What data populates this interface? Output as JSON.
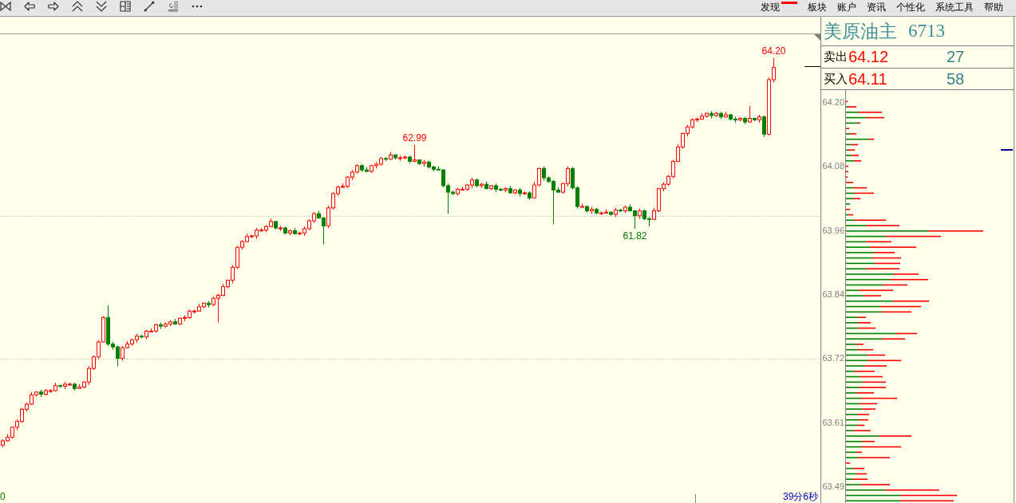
{
  "toolbar": {
    "menu": [
      {
        "label": "发现",
        "marked": true
      },
      {
        "label": "板块",
        "marked": false
      },
      {
        "label": "账户",
        "marked": false
      },
      {
        "label": "资讯",
        "marked": false
      },
      {
        "label": "个性化",
        "marked": false
      },
      {
        "label": "系统工具",
        "marked": false
      },
      {
        "label": "帮助",
        "marked": false
      }
    ]
  },
  "chart": {
    "annotations": [
      {
        "text": "64.20",
        "kind": "high"
      },
      {
        "text": "62.99",
        "kind": "high"
      },
      {
        "text": "61.82",
        "kind": "low"
      }
    ],
    "axis_label": "0",
    "countdown": "39分6秒"
  },
  "quote": {
    "instrument": "美原油主",
    "code": "6713",
    "rows": [
      {
        "label": "卖出",
        "price": "64.12",
        "volume": "27"
      },
      {
        "label": "买入",
        "price": "64.11",
        "volume": "58"
      }
    ]
  },
  "price_axis": [
    "64.20",
    "64.08",
    "63.96",
    "63.84",
    "63.72",
    "63.61",
    "63.49"
  ]
}
